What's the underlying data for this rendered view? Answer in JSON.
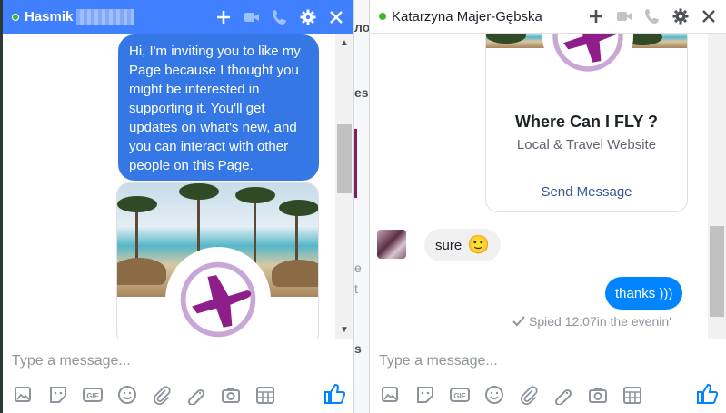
{
  "left_chat": {
    "contact_name": "Hasmik",
    "message_out": "Hi, I'm inviting you to like my Page because I thought you might be interested in supporting it. You'll get updates on what's new, and you can interact with other people on this Page.",
    "composer_placeholder": "Type a message..."
  },
  "right_chat": {
    "contact_name": "Katarzyna Majer-Gębska",
    "page_card": {
      "title": "Where Can I FLY ?",
      "subtitle": "Local & Travel Website",
      "button_label": "Send Message"
    },
    "message_in": "sure",
    "message_in_emoji": "🙂",
    "message_out": "thanks )))",
    "seen_status": "Spied 12:07in the evenin'",
    "composer_placeholder": "Type a message..."
  },
  "background_fragments": [
    "ло",
    "es",
    "e",
    "t",
    "s"
  ],
  "colors": {
    "header_blue": "#4080ff",
    "bubble_blue": "#0084ff",
    "online_green": "#42b72a",
    "logo_purple": "#8e1e8a"
  },
  "icons": {
    "header": [
      "plus-icon",
      "video-camera-icon",
      "phone-icon",
      "gear-icon",
      "close-icon"
    ],
    "composer_tools": [
      "image-icon",
      "sticker-icon",
      "gif-icon",
      "emoji-icon",
      "attach-icon",
      "game-icon",
      "camera-icon",
      "plan-icon"
    ],
    "send": "thumbs-up-icon"
  }
}
